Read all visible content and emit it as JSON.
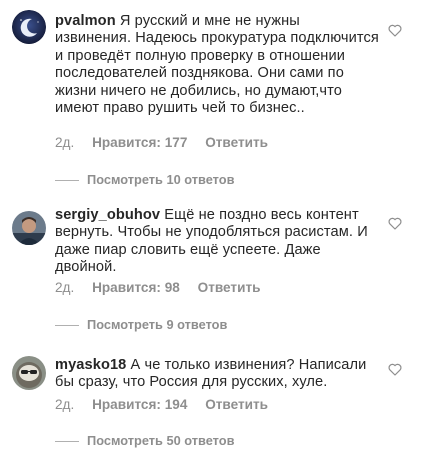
{
  "comments": [
    {
      "username": "pvalmon",
      "text": "Я русский и мне не нужны извинения. Надеюсь прокуратура подключится и проведёт полную проверку в отношении последователей позднякова. Они сами по жизни ничего не добились, но думают,что  имеют право рушить чей то бизнес..",
      "age": "2д.",
      "likes": "Нравится: 177",
      "reply": "Ответить",
      "view_replies": "Посмотреть 10 ответов",
      "like_icon": "heart-outline-icon"
    },
    {
      "username": "sergiy_obuhov",
      "text": "Ещё не поздно весь контент вернуть. Чтобы не уподобляться расистам. И даже пиар словить ещё успеете. Даже двойной.",
      "age": "2д.",
      "likes": "Нравится: 98",
      "reply": "Ответить",
      "view_replies": "Посмотреть 9 ответов",
      "like_icon": "heart-outline-icon"
    },
    {
      "username": "myasko18",
      "text": "А че только извинения? Написали бы сразу, что Россия для русских, хуле.",
      "age": "2д.",
      "likes": "Нравится: 194",
      "reply": "Ответить",
      "view_replies": "Посмотреть 50 ответов",
      "like_icon": "heart-outline-icon"
    }
  ],
  "colors": {
    "text": "#262626",
    "secondary": "#8e8e8e",
    "background": "#ffffff"
  }
}
